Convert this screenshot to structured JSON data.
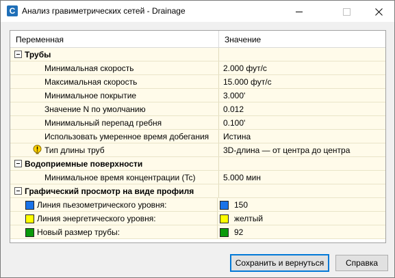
{
  "window": {
    "title": "Анализ гравиметрических сетей - Drainage",
    "app_icon_letter": "C"
  },
  "grid": {
    "col_variable": "Переменная",
    "col_value": "Значение",
    "categories": [
      {
        "label": "Трубы",
        "items": [
          {
            "name": "Минимальная скорость",
            "value": "2.000 фут/с"
          },
          {
            "name": "Максимальная скорость",
            "value": "15.000 фут/с"
          },
          {
            "name": "Минимальное покрытие",
            "value": "3.000'"
          },
          {
            "name": "Значение N по умолчанию",
            "value": "0.012"
          },
          {
            "name": "Минимальный перепад гребня",
            "value": "0.100'"
          },
          {
            "name": "Использовать умеренное время добегания",
            "value": "Истина"
          },
          {
            "name": "Тип длины труб",
            "value": "3D-длина — от центра до центра",
            "icon": "warning-icon"
          }
        ]
      },
      {
        "label": "Водоприемные поверхности",
        "items": [
          {
            "name": "Минимальное время концентрации (Tc)",
            "value": "5.000 мин"
          }
        ]
      },
      {
        "label": "Графический просмотр на виде профиля",
        "items": [
          {
            "name": "Линия пьезометрического уровня:",
            "value": "150",
            "color": "#1a73e8"
          },
          {
            "name": "Линия энергетического уровня:",
            "value": "желтый",
            "color": "#ffff00"
          },
          {
            "name": "Новый размер трубы:",
            "value": "92",
            "color": "#0a9a0a"
          }
        ]
      }
    ]
  },
  "buttons": {
    "save": "Сохранить и вернуться",
    "help": "Справка"
  }
}
